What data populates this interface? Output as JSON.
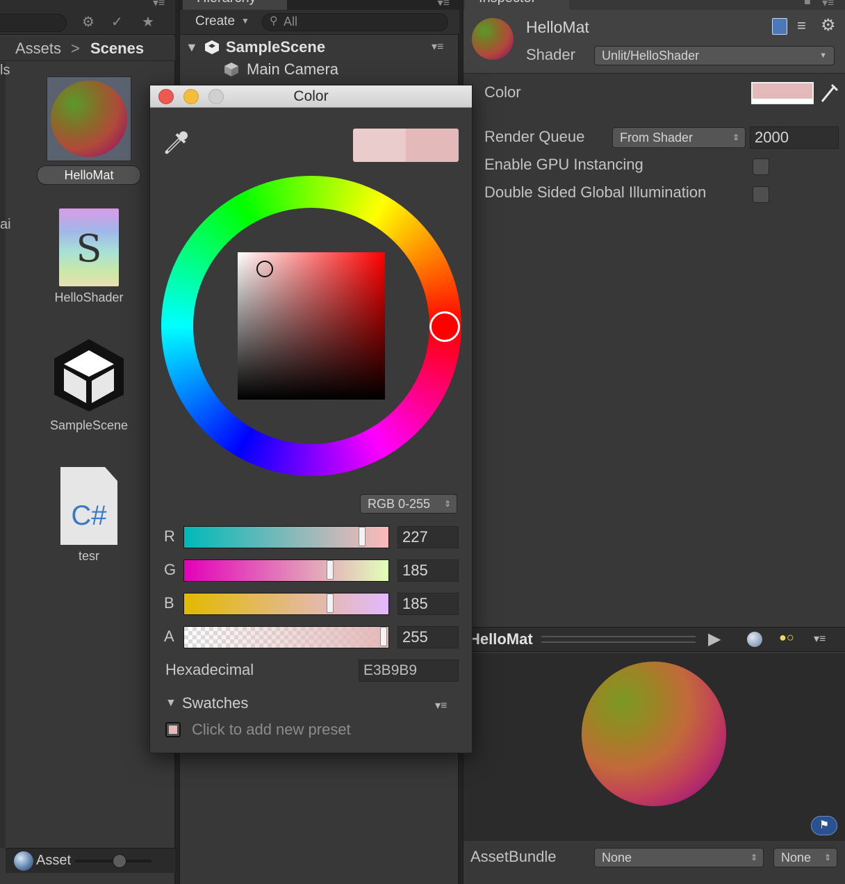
{
  "project": {
    "breadcrumb": [
      "Assets",
      "Scenes"
    ],
    "breadcrumb_sep": ">",
    "assets": [
      {
        "name": "HelloMat",
        "type": "material",
        "selected": true
      },
      {
        "name": "HelloShader",
        "type": "shader",
        "glyph": "S"
      },
      {
        "name": "SampleScene",
        "type": "scene"
      },
      {
        "name": "tesr",
        "type": "csharp",
        "glyph": "C#"
      }
    ],
    "bottom_label": "Asset",
    "left_edge_chars": [
      "ls",
      "ai"
    ]
  },
  "hierarchy": {
    "tab_title": "Hierarchy",
    "create_label": "Create",
    "search_placeholder": "All",
    "scene": "SampleScene",
    "items": [
      "Main Camera"
    ]
  },
  "inspector": {
    "tab_title": "Inspector",
    "material_name": "HelloMat",
    "shader_label": "Shader",
    "shader_value": "Unlit/HelloShader",
    "color_label": "Color",
    "color_value": "#E3B9B9",
    "render_queue_label": "Render Queue",
    "render_queue_mode": "From Shader",
    "render_queue_value": "2000",
    "gpu_instancing_label": "Enable GPU Instancing",
    "double_sided_gi_label": "Double Sided Global Illumination",
    "preview_title": "HelloMat",
    "assetbundle_label": "AssetBundle",
    "assetbundle_name": "None",
    "assetbundle_variant": "None"
  },
  "color_picker": {
    "title": "Color",
    "mode": "RGB 0-255",
    "channels": [
      {
        "name": "R",
        "value": 227,
        "max": 255
      },
      {
        "name": "G",
        "value": 185,
        "max": 255
      },
      {
        "name": "B",
        "value": 185,
        "max": 255
      },
      {
        "name": "A",
        "value": 255,
        "max": 255
      }
    ],
    "hex_label": "Hexadecimal",
    "hex_value": "E3B9B9",
    "swatches_label": "Swatches",
    "add_preset_label": "Click to add new preset",
    "current_color": "#E3B9B9",
    "previous_color": "#EBCCCC",
    "hue_color": "#FF0000"
  }
}
